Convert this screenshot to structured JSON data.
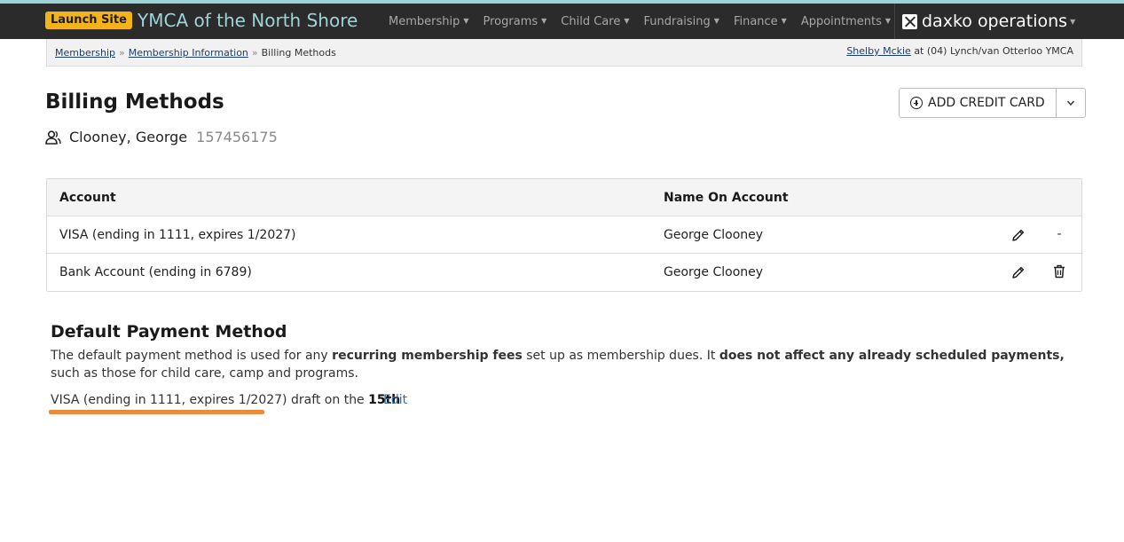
{
  "topbar": {
    "launch_label": "Launch Site",
    "org_name": "YMCA of the North Shore",
    "nav": [
      "Membership",
      "Programs",
      "Child Care",
      "Fundraising",
      "Finance",
      "Appointments"
    ],
    "brand": "daxko operations"
  },
  "breadcrumb": {
    "items": [
      "Membership",
      "Membership Information",
      "Billing Methods"
    ],
    "separator": "»"
  },
  "user": {
    "name": "Shelby Mckie",
    "location": "at (04) Lynch/van Otterloo YMCA"
  },
  "page": {
    "title": "Billing Methods",
    "member_name": "Clooney, George",
    "member_id": "157456175",
    "add_button": "ADD CREDIT CARD"
  },
  "table": {
    "headers": [
      "Account",
      "Name On Account"
    ],
    "rows": [
      {
        "account": "VISA (ending in 1111, expires 1/2027)",
        "name": "George Clooney",
        "delete": "-"
      },
      {
        "account": "Bank Account (ending in 6789)",
        "name": "George Clooney",
        "delete": ""
      }
    ]
  },
  "default_payment": {
    "title": "Default Payment Method",
    "desc_1": "The default payment method is used for any ",
    "desc_bold_1": "recurring membership fees",
    "desc_2": " set up as membership dues. It ",
    "desc_bold_2": "does not affect any already scheduled payments,",
    "desc_3": " such as those for child care, camp and programs.",
    "method": "VISA (ending in 1111, expires 1/2027)",
    "draft_text": " draft on the ",
    "draft_day": "15th",
    "edit_label": "Edit"
  },
  "colors": {
    "nav_bg": "#2b2b2b",
    "accent_teal": "#9fd4d6",
    "launch_bg": "#f2b31b",
    "highlight": "#e98a3c",
    "link": "#2e6aa8"
  }
}
